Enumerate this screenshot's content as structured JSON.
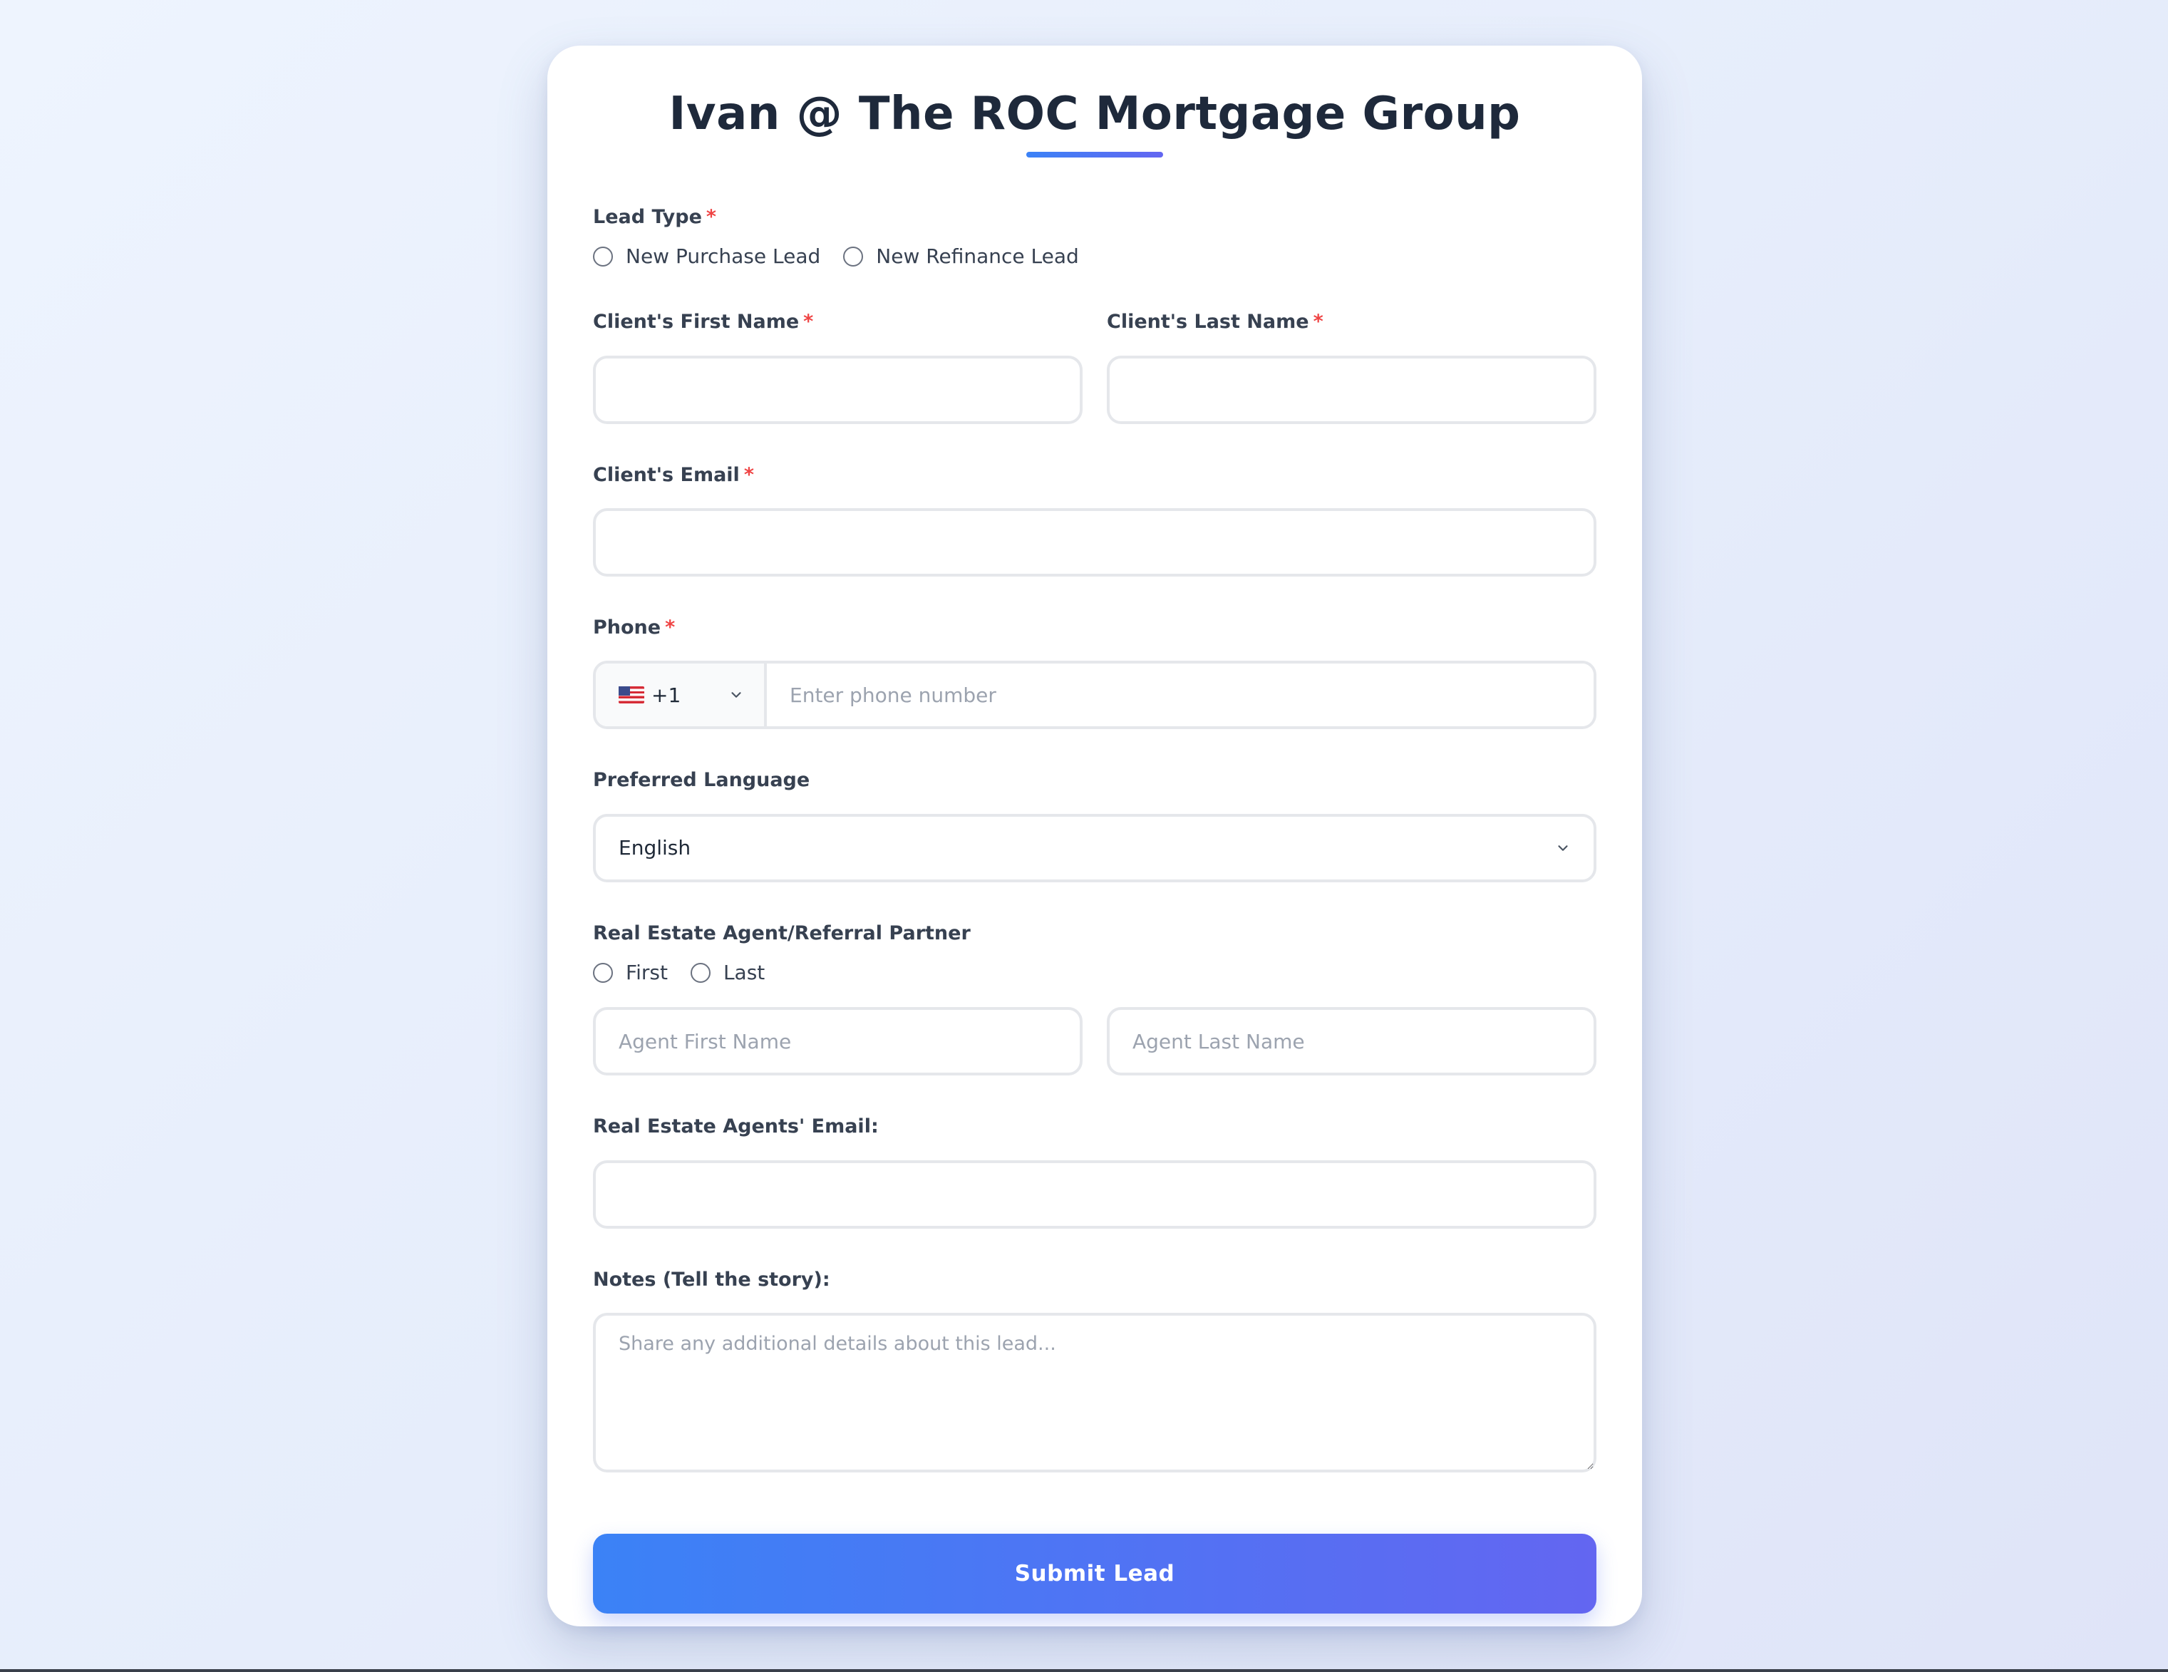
{
  "form": {
    "title": "Ivan @ The ROC Mortgage Group",
    "required_mark": "*"
  },
  "lead_type": {
    "label": "Lead Type",
    "options": [
      "New Purchase Lead",
      "New Refinance Lead"
    ]
  },
  "client": {
    "first_name_label": "Client's First Name",
    "first_name_value": "",
    "last_name_label": "Client's Last Name",
    "last_name_value": "",
    "email_label": "Client's Email",
    "email_value": ""
  },
  "phone": {
    "label": "Phone",
    "country_code": "+1",
    "country_flag": "us-flag-icon",
    "placeholder": "Enter phone number",
    "value": ""
  },
  "language": {
    "label": "Preferred Language",
    "selected": "English"
  },
  "agent": {
    "label": "Real Estate Agent/Referral Partner",
    "options": [
      "First",
      "Last"
    ],
    "first_name_placeholder": "Agent First Name",
    "last_name_placeholder": "Agent Last Name",
    "email_label": "Real Estate Agents' Email:",
    "email_value": ""
  },
  "notes": {
    "label": "Notes (Tell the story):",
    "placeholder": "Share any additional details about this lead..."
  },
  "submit": {
    "label": "Submit Lead"
  },
  "colors": {
    "accent_start": "#3b82f6",
    "accent_end": "#6366f1",
    "required": "#ef4444"
  }
}
